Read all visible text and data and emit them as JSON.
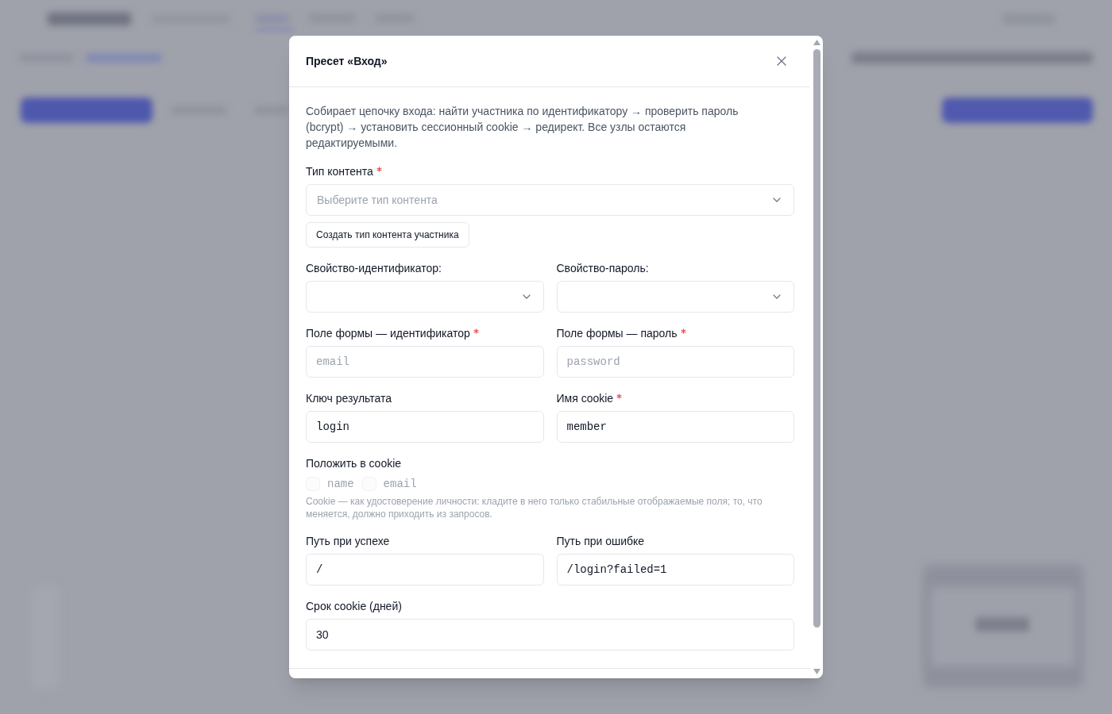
{
  "dialog": {
    "title": "Пресет «Вход»",
    "description": "Собирает цепочку входа: найти участника по идентификатору → проверить пароль (bcrypt) → установить сессионный cookie → редирект. Все узлы остаются редактируемыми.",
    "rows": [
      {
        "fields": [
          {
            "kind": "select",
            "label": "Тип контента",
            "required": true,
            "placeholder": "Выберите тип контента",
            "action": "Создать тип контента участника"
          }
        ]
      },
      {
        "fields": [
          {
            "kind": "select",
            "label": "Свойство-идентификатор:",
            "required": false
          },
          {
            "kind": "select",
            "label": "Свойство-пароль:",
            "required": false
          }
        ]
      },
      {
        "fields": [
          {
            "kind": "code",
            "label": "Поле формы — идентификатор",
            "required": true,
            "placeholder": "email"
          },
          {
            "kind": "code",
            "label": "Поле формы — пароль",
            "required": true,
            "placeholder": "password"
          }
        ]
      },
      {
        "fields": [
          {
            "kind": "code",
            "label": "Ключ результата",
            "required": false,
            "value": "login"
          },
          {
            "kind": "code",
            "label": "Имя cookie",
            "required": true,
            "value": "member"
          }
        ]
      },
      {
        "fields": [
          {
            "kind": "checkboxes",
            "label": "Положить в cookie",
            "required": false,
            "options": [
              {
                "label": "name",
                "checked": false,
                "disabled": true
              },
              {
                "label": "email",
                "checked": false,
                "disabled": true
              }
            ],
            "help": "Cookie — как удостоверение личности: кладите в него только стабильные отображаемые поля; то, что меняется, должно приходить из запросов."
          }
        ]
      },
      {
        "fields": [
          {
            "kind": "code",
            "label": "Путь при успехе",
            "required": false,
            "value": "/"
          },
          {
            "kind": "code",
            "label": "Путь при ошибке",
            "required": false,
            "value": "/login?failed=1"
          }
        ]
      },
      {
        "fields": [
          {
            "kind": "number",
            "label": "Срок cookie (дней)",
            "required": false,
            "value": "30"
          }
        ]
      }
    ]
  }
}
